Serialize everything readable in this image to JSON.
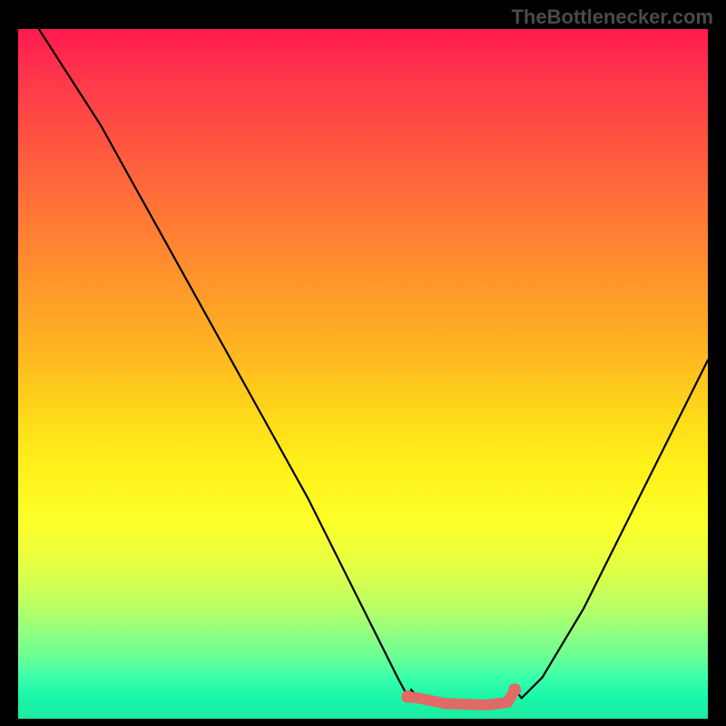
{
  "watermark": "TheBottlenecker.com",
  "chart_data": {
    "type": "line",
    "title": "",
    "xlabel": "",
    "ylabel": "",
    "xlim": [
      0,
      100
    ],
    "ylim": [
      0,
      100
    ],
    "series": [
      {
        "name": "curve",
        "points": [
          {
            "x": 3,
            "y": 100
          },
          {
            "x": 12,
            "y": 86
          },
          {
            "x": 22,
            "y": 68
          },
          {
            "x": 32,
            "y": 50
          },
          {
            "x": 42,
            "y": 32
          },
          {
            "x": 50,
            "y": 16
          },
          {
            "x": 55,
            "y": 6
          },
          {
            "x": 56.5,
            "y": 3.2
          },
          {
            "x": 57,
            "y": 4.2
          },
          {
            "x": 58,
            "y": 3.0
          },
          {
            "x": 62,
            "y": 2.2
          },
          {
            "x": 68,
            "y": 2.0
          },
          {
            "x": 71,
            "y": 2.4
          },
          {
            "x": 72,
            "y": 4.2
          },
          {
            "x": 73,
            "y": 3.0
          },
          {
            "x": 76,
            "y": 6
          },
          {
            "x": 82,
            "y": 16
          },
          {
            "x": 90,
            "y": 32
          },
          {
            "x": 100,
            "y": 52
          }
        ]
      },
      {
        "name": "highlight",
        "color": "#e06a66",
        "points": [
          {
            "x": 56.5,
            "y": 3.2
          },
          {
            "x": 58,
            "y": 3.0
          },
          {
            "x": 62,
            "y": 2.2
          },
          {
            "x": 68,
            "y": 2.0
          },
          {
            "x": 71,
            "y": 2.4
          },
          {
            "x": 72,
            "y": 4.2
          }
        ]
      }
    ],
    "background_gradient": {
      "top": "#ff1a4f",
      "mid": "#fff21a",
      "bottom": "#1de9a3"
    }
  }
}
